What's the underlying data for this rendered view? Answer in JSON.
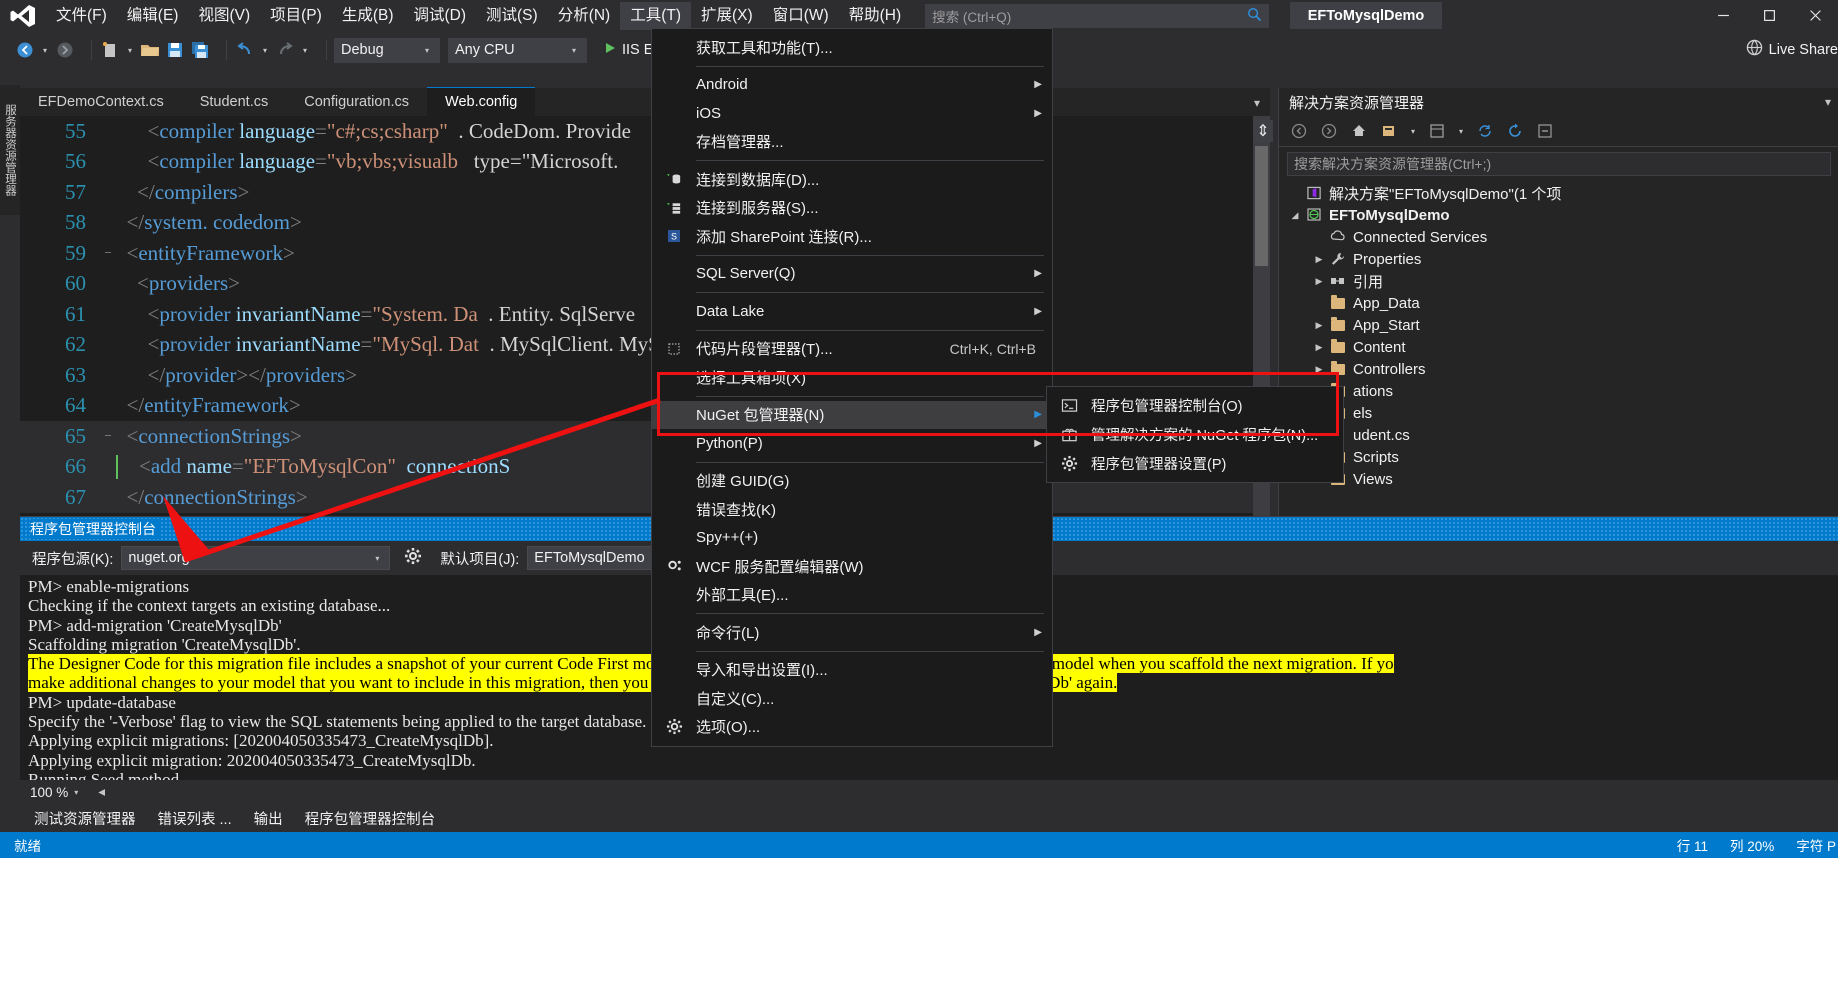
{
  "window": {
    "title": "EFToMysqlDemo",
    "logo_icon": "visual-studio-logo",
    "minimize_icon": "minimize-icon",
    "maximize_icon": "maximize-icon",
    "close_icon": "close-icon"
  },
  "menubar": {
    "items": [
      {
        "label": "文件(F)",
        "open": false
      },
      {
        "label": "编辑(E)",
        "open": false
      },
      {
        "label": "视图(V)",
        "open": false
      },
      {
        "label": "项目(P)",
        "open": false
      },
      {
        "label": "生成(B)",
        "open": false
      },
      {
        "label": "调试(D)",
        "open": false
      },
      {
        "label": "测试(S)",
        "open": false
      },
      {
        "label": "分析(N)",
        "open": false
      },
      {
        "label": "工具(T)",
        "open": true
      },
      {
        "label": "扩展(X)",
        "open": false
      },
      {
        "label": "窗口(W)",
        "open": false
      },
      {
        "label": "帮助(H)",
        "open": false
      }
    ],
    "search_placeholder": "搜索 (Ctrl+Q)",
    "search_icon": "search-icon"
  },
  "toolbar": {
    "back_icon": "navigate-back-icon",
    "forward_icon": "navigate-forward-icon",
    "new_item_icon": "new-item-icon",
    "open_icon": "open-folder-icon",
    "save_icon": "save-icon",
    "save_all_icon": "save-all-icon",
    "undo_icon": "undo-icon",
    "redo_icon": "redo-icon",
    "config_value": "Debug",
    "platform_value": "Any CPU",
    "run_label": "IIS E",
    "run_icon": "play-icon",
    "live_share_label": "Live Share",
    "live_share_icon": "live-share-icon"
  },
  "left_vertical_tab": {
    "label": "服务器资源管理器"
  },
  "document_tabs": {
    "items": [
      {
        "label": "EFDemoContext.cs",
        "active": false
      },
      {
        "label": "Student.cs",
        "active": false
      },
      {
        "label": "Configuration.cs",
        "active": false
      },
      {
        "label": "Web.config",
        "active": true
      }
    ],
    "overflow_icon": "chevron-down-icon"
  },
  "editor": {
    "split_icon": "split-view-icon",
    "lines": [
      {
        "number": "55",
        "fold": "",
        "segments": [
          {
            "t": "      ",
            "c": "pl"
          },
          {
            "t": "<",
            "c": "br"
          },
          {
            "t": "compiler",
            "c": "tg"
          },
          {
            "t": " ",
            "c": "pl"
          },
          {
            "t": "language",
            "c": "at"
          },
          {
            "t": "=",
            "c": "br"
          },
          {
            "t": "\"c#;cs;csharp\"",
            "c": "vl"
          },
          {
            "t": "  ",
            "c": "pl"
          },
          {
            "t": ". CodeDom. Provide",
            "c": "pl"
          }
        ]
      },
      {
        "number": "56",
        "fold": "",
        "segments": [
          {
            "t": "      ",
            "c": "pl"
          },
          {
            "t": "<",
            "c": "br"
          },
          {
            "t": "compiler",
            "c": "tg"
          },
          {
            "t": " ",
            "c": "pl"
          },
          {
            "t": "language",
            "c": "at"
          },
          {
            "t": "=",
            "c": "br"
          },
          {
            "t": "\"vb;vbs;visualb",
            "c": "vl"
          },
          {
            "t": "   type=\"Microsoft.",
            "c": "pl"
          }
        ]
      },
      {
        "number": "57",
        "fold": "",
        "segments": [
          {
            "t": "    ",
            "c": "pl"
          },
          {
            "t": "</",
            "c": "br"
          },
          {
            "t": "compilers",
            "c": "tg"
          },
          {
            "t": ">",
            "c": "br"
          }
        ]
      },
      {
        "number": "58",
        "fold": "",
        "segments": [
          {
            "t": "  ",
            "c": "pl"
          },
          {
            "t": "</",
            "c": "br"
          },
          {
            "t": "system. codedom",
            "c": "tg"
          },
          {
            "t": ">",
            "c": "br"
          }
        ]
      },
      {
        "number": "59",
        "fold": "−",
        "segments": [
          {
            "t": "  ",
            "c": "pl"
          },
          {
            "t": "<",
            "c": "br"
          },
          {
            "t": "entityFramework",
            "c": "tg"
          },
          {
            "t": ">",
            "c": "br"
          }
        ]
      },
      {
        "number": "60",
        "fold": "",
        "segments": [
          {
            "t": "    ",
            "c": "pl"
          },
          {
            "t": "<",
            "c": "br"
          },
          {
            "t": "providers",
            "c": "tg"
          },
          {
            "t": ">",
            "c": "br"
          }
        ]
      },
      {
        "number": "61",
        "fold": "",
        "segments": [
          {
            "t": "      ",
            "c": "pl"
          },
          {
            "t": "<",
            "c": "br"
          },
          {
            "t": "provider",
            "c": "tg"
          },
          {
            "t": " ",
            "c": "pl"
          },
          {
            "t": "invariantName",
            "c": "at"
          },
          {
            "t": "=",
            "c": "br"
          },
          {
            "t": "\"System. Da",
            "c": "vl"
          },
          {
            "t": "  . Entity. SqlServe",
            "c": "pl"
          }
        ]
      },
      {
        "number": "62",
        "fold": "",
        "segments": [
          {
            "t": "      ",
            "c": "pl"
          },
          {
            "t": "<",
            "c": "br"
          },
          {
            "t": "provider",
            "c": "tg"
          },
          {
            "t": " ",
            "c": "pl"
          },
          {
            "t": "invariantName",
            "c": "at"
          },
          {
            "t": "=",
            "c": "br"
          },
          {
            "t": "\"MySql. Dat",
            "c": "vl"
          },
          {
            "t": "  . MySqlClient. MyS",
            "c": "pl"
          }
        ]
      },
      {
        "number": "63",
        "fold": "",
        "segments": [
          {
            "t": "      ",
            "c": "pl"
          },
          {
            "t": "</",
            "c": "br"
          },
          {
            "t": "provider",
            "c": "tg"
          },
          {
            "t": "></",
            "c": "br"
          },
          {
            "t": "providers",
            "c": "tg"
          },
          {
            "t": ">",
            "c": "br"
          }
        ]
      },
      {
        "number": "64",
        "fold": "",
        "segments": [
          {
            "t": "  ",
            "c": "pl"
          },
          {
            "t": "</",
            "c": "br"
          },
          {
            "t": "entityFramework",
            "c": "tg"
          },
          {
            "t": ">",
            "c": "br"
          }
        ]
      },
      {
        "number": "65",
        "fold": "−",
        "segments": [
          {
            "t": "  ",
            "c": "pl"
          },
          {
            "t": "<",
            "c": "br"
          },
          {
            "t": "connectionStrings",
            "c": "tg"
          },
          {
            "t": ">",
            "c": "br"
          }
        ]
      },
      {
        "number": "66",
        "fold": "",
        "segments": [
          {
            "t": "    ",
            "c": "pl"
          },
          {
            "t": "<",
            "c": "br"
          },
          {
            "t": "add",
            "c": "tg"
          },
          {
            "t": " ",
            "c": "pl"
          },
          {
            "t": "name",
            "c": "at"
          },
          {
            "t": "=",
            "c": "br"
          },
          {
            "t": "\"EFToMysqlCon\"",
            "c": "vl"
          },
          {
            "t": "  ",
            "c": "pl"
          },
          {
            "t": "connectionS",
            "c": "at"
          }
        ]
      },
      {
        "number": "67",
        "fold": "",
        "segments": [
          {
            "t": "  ",
            "c": "pl"
          },
          {
            "t": "</",
            "c": "br"
          },
          {
            "t": "connectionStrings",
            "c": "tg"
          },
          {
            "t": ">",
            "c": "br"
          }
        ]
      }
    ]
  },
  "tools_menu": {
    "items": [
      {
        "label": "获取工具和功能(T)...",
        "icon": "",
        "accel": "",
        "arrow": false,
        "sep_after": true
      },
      {
        "label": "Android",
        "icon": "",
        "accel": "",
        "arrow": true,
        "sep_after": false
      },
      {
        "label": "iOS",
        "icon": "",
        "accel": "",
        "arrow": true,
        "sep_after": false
      },
      {
        "label": "存档管理器...",
        "icon": "",
        "accel": "",
        "arrow": false,
        "sep_after": true
      },
      {
        "label": "连接到数据库(D)...",
        "icon": "database-connect-icon",
        "accel": "",
        "arrow": false,
        "sep_after": false
      },
      {
        "label": "连接到服务器(S)...",
        "icon": "server-connect-icon",
        "accel": "",
        "arrow": false,
        "sep_after": false
      },
      {
        "label": "添加 SharePoint 连接(R)...",
        "icon": "sharepoint-icon",
        "accel": "",
        "arrow": false,
        "sep_after": true
      },
      {
        "label": "SQL Server(Q)",
        "icon": "",
        "accel": "",
        "arrow": true,
        "sep_after": true
      },
      {
        "label": "Data Lake",
        "icon": "",
        "accel": "",
        "arrow": true,
        "sep_after": true
      },
      {
        "label": "代码片段管理器(T)...",
        "icon": "snippet-icon",
        "accel": "Ctrl+K, Ctrl+B",
        "arrow": false,
        "sep_after": false
      },
      {
        "label": "选择工具箱项(X)",
        "icon": "",
        "accel": "",
        "arrow": false,
        "sep_after": true
      },
      {
        "label": "NuGet 包管理器(N)",
        "icon": "",
        "accel": "",
        "arrow": true,
        "sep_after": false,
        "highlighted": true
      },
      {
        "label": "Python(P)",
        "icon": "",
        "accel": "",
        "arrow": true,
        "sep_after": true
      },
      {
        "label": "创建 GUID(G)",
        "icon": "",
        "accel": "",
        "arrow": false,
        "sep_after": false
      },
      {
        "label": "错误查找(K)",
        "icon": "",
        "accel": "",
        "arrow": false,
        "sep_after": false
      },
      {
        "label": "Spy++(+)",
        "icon": "",
        "accel": "",
        "arrow": false,
        "sep_after": false
      },
      {
        "label": "WCF 服务配置编辑器(W)",
        "icon": "wcf-icon",
        "accel": "",
        "arrow": false,
        "sep_after": false
      },
      {
        "label": "外部工具(E)...",
        "icon": "",
        "accel": "",
        "arrow": false,
        "sep_after": true
      },
      {
        "label": "命令行(L)",
        "icon": "",
        "accel": "",
        "arrow": true,
        "sep_after": true
      },
      {
        "label": "导入和导出设置(I)...",
        "icon": "",
        "accel": "",
        "arrow": false,
        "sep_after": false
      },
      {
        "label": "自定义(C)...",
        "icon": "",
        "accel": "",
        "arrow": false,
        "sep_after": false
      },
      {
        "label": "选项(O)...",
        "icon": "options-gear-icon",
        "accel": "",
        "arrow": false,
        "sep_after": false
      }
    ]
  },
  "nuget_submenu": {
    "items": [
      {
        "label": "程序包管理器控制台(O)",
        "icon": "console-icon"
      },
      {
        "label": "管理解决方案的 NuGet 程序包(N)...",
        "icon": "package-icon"
      },
      {
        "label": "程序包管理器设置(P)",
        "icon": "gear-icon"
      }
    ]
  },
  "solution_explorer": {
    "title": "解决方案资源管理器",
    "close_icon": "chevron-down-icon",
    "toolbar_icons": [
      "navigate-back-icon",
      "navigate-forward-icon",
      "home-icon",
      "pending-changes-icon",
      "properties-icon",
      "sync-icon",
      "refresh-icon",
      "collapse-all-icon"
    ],
    "search_placeholder": "搜索解决方案资源管理器(Ctrl+;)",
    "tree": [
      {
        "label": "解决方案\"EFToMysqlDemo\"(1 个项",
        "indent": 0,
        "icon": "solution-icon",
        "expander": "",
        "bold": false
      },
      {
        "label": "EFToMysqlDemo",
        "indent": 0,
        "icon": "web-project-icon",
        "expander": "▼",
        "bold": true
      },
      {
        "label": "Connected Services",
        "indent": 1,
        "icon": "connected-services-icon",
        "expander": "",
        "bold": false
      },
      {
        "label": "Properties",
        "indent": 1,
        "icon": "wrench-icon",
        "expander": "▶",
        "bold": false
      },
      {
        "label": "引用",
        "indent": 1,
        "icon": "references-icon",
        "expander": "▶",
        "bold": false
      },
      {
        "label": "App_Data",
        "indent": 1,
        "icon": "folder-icon",
        "expander": "",
        "bold": false
      },
      {
        "label": "App_Start",
        "indent": 1,
        "icon": "folder-icon",
        "expander": "▶",
        "bold": false
      },
      {
        "label": "Content",
        "indent": 1,
        "icon": "folder-icon",
        "expander": "▶",
        "bold": false
      },
      {
        "label": "Controllers",
        "indent": 1,
        "icon": "folder-icon",
        "expander": "▶",
        "bold": false
      },
      {
        "label": "ations",
        "indent": 1,
        "icon": "folder-icon",
        "expander": "",
        "bold": false
      },
      {
        "label": "els",
        "indent": 1,
        "icon": "folder-icon",
        "expander": "",
        "bold": false
      },
      {
        "label": "udent.cs",
        "indent": 1,
        "icon": "csharp-icon",
        "expander": "",
        "bold": false
      },
      {
        "label": "Scripts",
        "indent": 1,
        "icon": "folder-icon",
        "expander": "▶",
        "bold": false
      },
      {
        "label": "Views",
        "indent": 1,
        "icon": "folder-icon",
        "expander": "▶",
        "bold": false
      }
    ]
  },
  "package_console": {
    "title": "程序包管理器控制台",
    "source_label": "程序包源(K):",
    "source_value": "nuget.org",
    "settings_icon": "gear-icon",
    "project_label": "默认项目(J):",
    "project_value": "EFToMysqlDemo",
    "lines": [
      {
        "text": "PM> enable-migrations",
        "highlight": false
      },
      {
        "text": "Checking if the context targets an existing database...",
        "highlight": false
      },
      {
        "text": "PM> add-migration 'CreateMysqlDb'",
        "highlight": false
      },
      {
        "text": "Scaffolding migration 'CreateMysqlDb'.",
        "highlight": false
      },
      {
        "text": "The Designer Code for this migration file includes a snapshot of your current Code First model. This snapshot is used to calculate the changes to your model when you scaffold the next migration. If yo",
        "highlight": true
      },
      {
        "text": "make additional changes to your model that you want to include in this migration, then you can re-scaffold it by running 'Add-Migration CreateMysqlDb' again.",
        "highlight": true
      },
      {
        "text": "PM> update-database",
        "highlight": false
      },
      {
        "text": "Specify the '-Verbose' flag to view the SQL statements being applied to the target database.",
        "highlight": false
      },
      {
        "text": "Applying explicit migrations: [202004050335473_CreateMysqlDb].",
        "highlight": false
      },
      {
        "text": "Applying explicit migration: 202004050335473_CreateMysqlDb.",
        "highlight": false
      },
      {
        "text": "Running Seed method.",
        "highlight": false
      }
    ]
  },
  "zoom_bar": {
    "value": "100 %",
    "nav_icon": "chevron-left-icon"
  },
  "bottom_tabs": {
    "items": [
      "测试资源管理器",
      "错误列表 ...",
      "输出",
      "程序包管理器控制台"
    ]
  },
  "status_bar": {
    "text": "就绪",
    "right_items": [
      "行 11",
      "列 20%",
      "字符 P"
    ]
  }
}
